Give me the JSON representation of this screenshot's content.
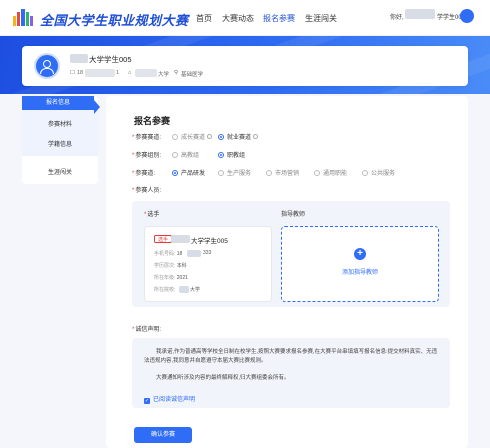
{
  "header": {
    "brand": "全国大学生职业规划大赛",
    "nav": [
      "首页",
      "大赛动态",
      "报名参赛",
      "生涯闯关"
    ],
    "active_nav": "报名参赛",
    "greeting": "你好,",
    "user_suffix": "学学生005"
  },
  "profile": {
    "name_suffix": "大学学生005",
    "phone_prefix": "18",
    "phone_suffix": "1",
    "school_suffix": "大学",
    "major": "基础医学"
  },
  "sidebar": {
    "items": [
      {
        "label": "报名信息",
        "active": true
      },
      {
        "label": "参赛材料",
        "active": false
      },
      {
        "label": "学籍信息",
        "active": false
      },
      {
        "label": "生涯闯关",
        "active": false
      }
    ]
  },
  "form": {
    "title": "报名参赛",
    "track": {
      "label": "参赛赛道:",
      "options": [
        {
          "label": "成长赛道",
          "selected": false
        },
        {
          "label": "就业赛道",
          "selected": true
        }
      ]
    },
    "group": {
      "label": "参赛组别:",
      "options": [
        {
          "label": "高教组",
          "selected": false
        },
        {
          "label": "职教组",
          "selected": true
        }
      ]
    },
    "category": {
      "label": "参赛道:",
      "options": [
        {
          "label": "产品研发",
          "selected": true
        },
        {
          "label": "生产服务",
          "selected": false
        },
        {
          "label": "市场营销",
          "selected": false
        },
        {
          "label": "通用职能",
          "selected": false
        },
        {
          "label": "公共服务",
          "selected": false
        }
      ]
    },
    "members": {
      "label": "参赛人员:",
      "player_heading": "选手",
      "mentor_heading": "指导教师",
      "player": {
        "tag": "选手",
        "name_suffix": "大学学生005",
        "phone_label": "手机号码:",
        "phone_prefix": "18",
        "phone_suffix": "333",
        "edu_label": "学历层次:",
        "edu_value": "本科",
        "year_label": "所在年级:",
        "year_value": "2021",
        "school_label": "所在院校:",
        "school_suffix": "大学"
      },
      "add_mentor": "添加指导教师"
    },
    "declaration": {
      "label": "诚信声明:",
      "para1": "我承诺,作为普通高等学校全日制在校学生,按照大赛要求报名参赛,在大赛平台串填填写报名信息:提交材料真实、无违法违规内容,我同意并自愿遵守本届大赛比赛规则。",
      "para2": "大赛通知听涉及内容的最终解释权,归大赛组委会所有。",
      "check_label": "已阅读诚信声明",
      "checked": true
    },
    "submit_label": "确认参赛"
  }
}
